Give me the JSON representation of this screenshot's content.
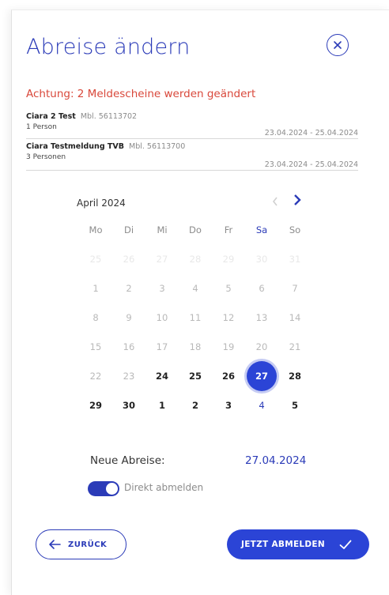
{
  "dialog": {
    "title": "Abreise ändern",
    "warning": "Achtung: 2 Meldescheine werden geändert"
  },
  "guests": [
    {
      "name": "Ciara 2 Test",
      "mbl": "Mbl. 56113702",
      "persons": "1 Person",
      "dates": "23.04.2024 - 25.04.2024"
    },
    {
      "name": "Ciara Testmeldung TVB",
      "mbl": "Mbl. 56113700",
      "persons": "3 Personen",
      "dates": "23.04.2024 - 25.04.2024"
    }
  ],
  "calendar": {
    "month": "April 2024",
    "prev_icon": "chevron-left-icon",
    "next_icon": "chevron-right-icon",
    "weekdays": [
      "Mo",
      "Di",
      "Mi",
      "Do",
      "Fr",
      "Sa",
      "So"
    ],
    "weeks": [
      [
        "25",
        "26",
        "27",
        "28",
        "29",
        "30",
        "31"
      ],
      [
        "1",
        "2",
        "3",
        "4",
        "5",
        "6",
        "7"
      ],
      [
        "8",
        "9",
        "10",
        "11",
        "12",
        "13",
        "14"
      ],
      [
        "15",
        "16",
        "17",
        "18",
        "19",
        "20",
        "21"
      ],
      [
        "22",
        "23",
        "24",
        "25",
        "26",
        "27",
        "28"
      ],
      [
        "29",
        "30",
        "1",
        "2",
        "3",
        "4",
        "5"
      ]
    ],
    "selected": "27"
  },
  "summary": {
    "new_departure_label": "Neue Abreise:",
    "new_departure_value": "27.04.2024",
    "toggle_label": "Direkt abmelden",
    "toggle_on": true
  },
  "actions": {
    "back_label": "ZURÜCK",
    "submit_label": "JETZT ABMELDEN"
  },
  "colors": {
    "accent": "#2b3bb8",
    "selected_bg": "#2b44d6",
    "warning": "#d9483b"
  }
}
